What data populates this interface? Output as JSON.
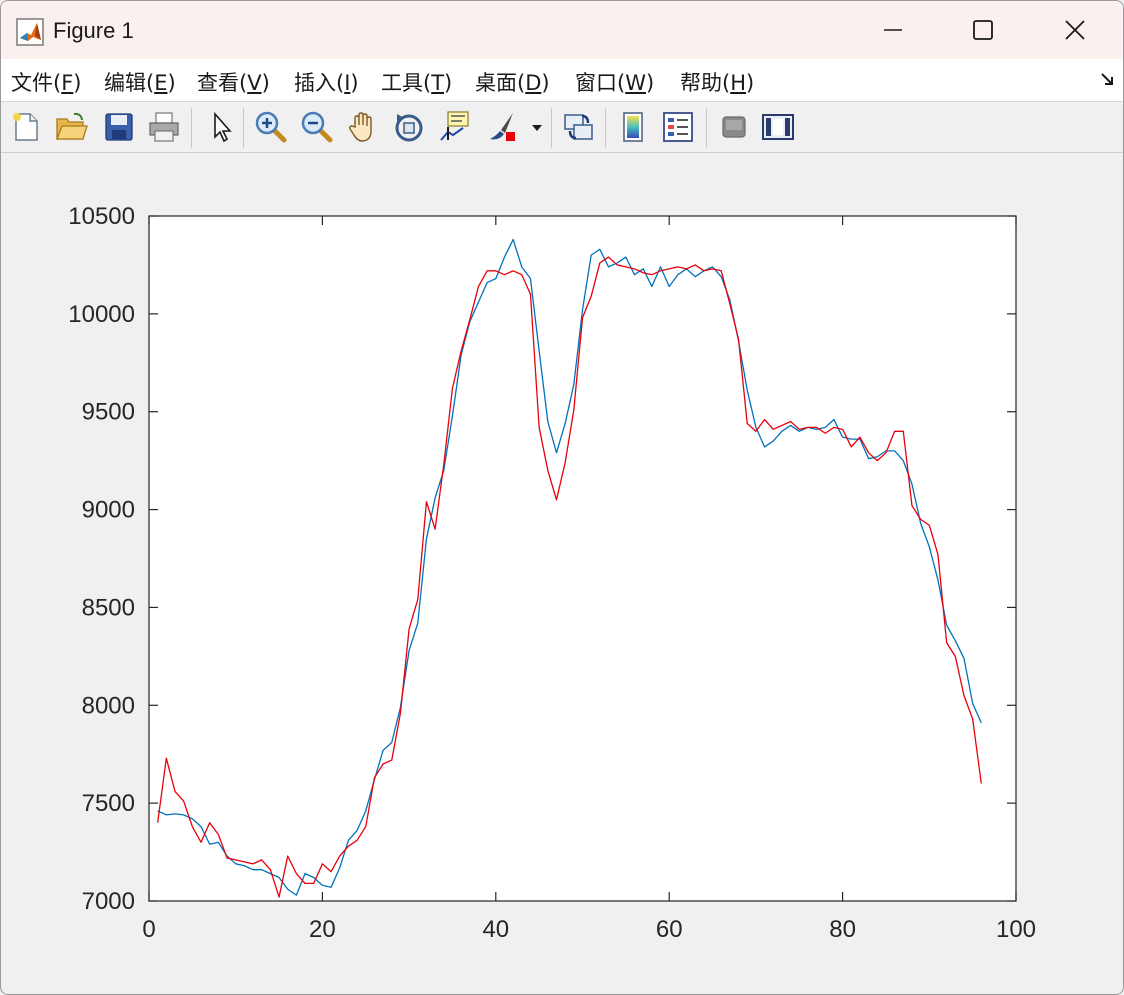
{
  "window": {
    "title": "Figure 1",
    "accent": "#faf0ee"
  },
  "menu": {
    "items": [
      {
        "label": "文件(F)",
        "underline": "F"
      },
      {
        "label": "编辑(E)",
        "underline": "E"
      },
      {
        "label": "查看(V)",
        "underline": "V"
      },
      {
        "label": "插入(I)",
        "underline": "I"
      },
      {
        "label": "工具(T)",
        "underline": "T"
      },
      {
        "label": "桌面(D)",
        "underline": "D"
      },
      {
        "label": "窗口(W)",
        "underline": "W"
      },
      {
        "label": "帮助(H)",
        "underline": "H"
      }
    ]
  },
  "toolbar": {
    "icons": [
      "new-figure-icon",
      "open-file-icon",
      "save-icon",
      "print-icon",
      "select-pointer-icon",
      "zoom-in-icon",
      "zoom-out-icon",
      "pan-hand-icon",
      "rotate-3d-icon",
      "data-cursor-icon",
      "brush-icon",
      "link-plot-icon",
      "colorbar-icon",
      "legend-icon",
      "hide-plot-tools-icon",
      "show-plot-tools-icon"
    ]
  },
  "chart_data": {
    "type": "line",
    "title": "",
    "xlabel": "",
    "ylabel": "",
    "xlim": [
      0,
      100
    ],
    "ylim": [
      7000,
      10500
    ],
    "xticks": [
      0,
      20,
      40,
      60,
      80,
      100
    ],
    "yticks": [
      7000,
      7500,
      8000,
      8500,
      9000,
      9500,
      10000,
      10500
    ],
    "grid": false,
    "x": [
      1,
      2,
      3,
      4,
      5,
      6,
      7,
      8,
      9,
      10,
      11,
      12,
      13,
      14,
      15,
      16,
      17,
      18,
      19,
      20,
      21,
      22,
      23,
      24,
      25,
      26,
      27,
      28,
      29,
      30,
      31,
      32,
      33,
      34,
      35,
      36,
      37,
      38,
      39,
      40,
      41,
      42,
      43,
      44,
      45,
      46,
      47,
      48,
      49,
      50,
      51,
      52,
      53,
      54,
      55,
      56,
      57,
      58,
      59,
      60,
      61,
      62,
      63,
      64,
      65,
      66,
      67,
      68,
      69,
      70,
      71,
      72,
      73,
      74,
      75,
      76,
      77,
      78,
      79,
      80,
      81,
      82,
      83,
      84,
      85,
      86,
      87,
      88,
      89,
      90,
      91,
      92,
      93,
      94,
      95,
      96
    ],
    "series": [
      {
        "color": "#0072bd",
        "values": [
          7460,
          7440,
          7445,
          7440,
          7420,
          7380,
          7290,
          7300,
          7230,
          7190,
          7180,
          7160,
          7160,
          7140,
          7120,
          7060,
          7030,
          7140,
          7120,
          7080,
          7070,
          7170,
          7310,
          7360,
          7460,
          7620,
          7770,
          7810,
          7990,
          8280,
          8420,
          8850,
          9060,
          9200,
          9480,
          9790,
          9960,
          10060,
          10160,
          10180,
          10290,
          10380,
          10240,
          10180,
          9810,
          9450,
          9290,
          9440,
          9640,
          10020,
          10300,
          10330,
          10240,
          10260,
          10290,
          10200,
          10230,
          10140,
          10240,
          10140,
          10200,
          10230,
          10190,
          10220,
          10240,
          10190,
          10070,
          9860,
          9610,
          9420,
          9320,
          9350,
          9400,
          9430,
          9400,
          9420,
          9410,
          9420,
          9460,
          9370,
          9360,
          9360,
          9260,
          9270,
          9300,
          9300,
          9250,
          9130,
          8930,
          8810,
          8640,
          8410,
          8330,
          8240,
          8010,
          7910
        ]
      },
      {
        "color": "#e8000b",
        "values": [
          7400,
          7730,
          7560,
          7510,
          7380,
          7300,
          7400,
          7340,
          7220,
          7210,
          7200,
          7190,
          7210,
          7160,
          7020,
          7230,
          7140,
          7090,
          7090,
          7190,
          7150,
          7230,
          7280,
          7310,
          7380,
          7630,
          7700,
          7720,
          7960,
          8390,
          8540,
          9040,
          8900,
          9230,
          9620,
          9810,
          9970,
          10140,
          10220,
          10220,
          10200,
          10220,
          10200,
          10100,
          9420,
          9200,
          9050,
          9240,
          9510,
          9980,
          10090,
          10260,
          10290,
          10250,
          10240,
          10230,
          10210,
          10200,
          10220,
          10230,
          10240,
          10230,
          10250,
          10220,
          10230,
          10220,
          10050,
          9870,
          9440,
          9400,
          9460,
          9410,
          9430,
          9450,
          9410,
          9420,
          9420,
          9390,
          9420,
          9410,
          9320,
          9370,
          9290,
          9250,
          9290,
          9400,
          9400,
          9020,
          8950,
          8920,
          8770,
          8320,
          8250,
          8050,
          7930,
          7600
        ]
      }
    ]
  }
}
